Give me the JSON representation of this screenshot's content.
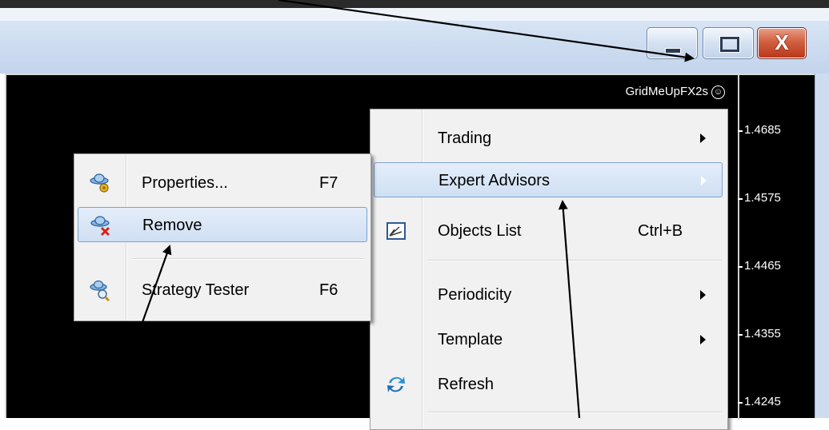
{
  "chart": {
    "ea_name": "GridMeUpFX2s",
    "prices": [
      "1.4685",
      "1.4575",
      "1.4465",
      "1.4355",
      "1.4245"
    ]
  },
  "context_menu": {
    "items": [
      {
        "label": "Trading",
        "submenu": true
      },
      {
        "label": "Expert Advisors",
        "submenu": true,
        "highlighted": true
      },
      {
        "label": "Objects List",
        "shortcut": "Ctrl+B",
        "icon": "objects-list-icon"
      },
      {
        "label": "Periodicity",
        "submenu": true
      },
      {
        "label": "Template",
        "submenu": true
      },
      {
        "label": "Refresh",
        "icon": "refresh-icon"
      }
    ]
  },
  "expert_submenu": {
    "items": [
      {
        "label": "Properties...",
        "shortcut": "F7",
        "icon": "expert-properties-icon"
      },
      {
        "label": "Remove",
        "icon": "expert-remove-icon",
        "highlighted": true
      },
      {
        "label": "Strategy Tester",
        "shortcut": "F6",
        "icon": "strategy-tester-icon"
      }
    ]
  },
  "window_controls": {
    "close_glyph": "X"
  },
  "colors": {
    "chart_background": "#000000",
    "highlight_border": "#7da2ce",
    "menu_background": "#f1f1f1"
  }
}
